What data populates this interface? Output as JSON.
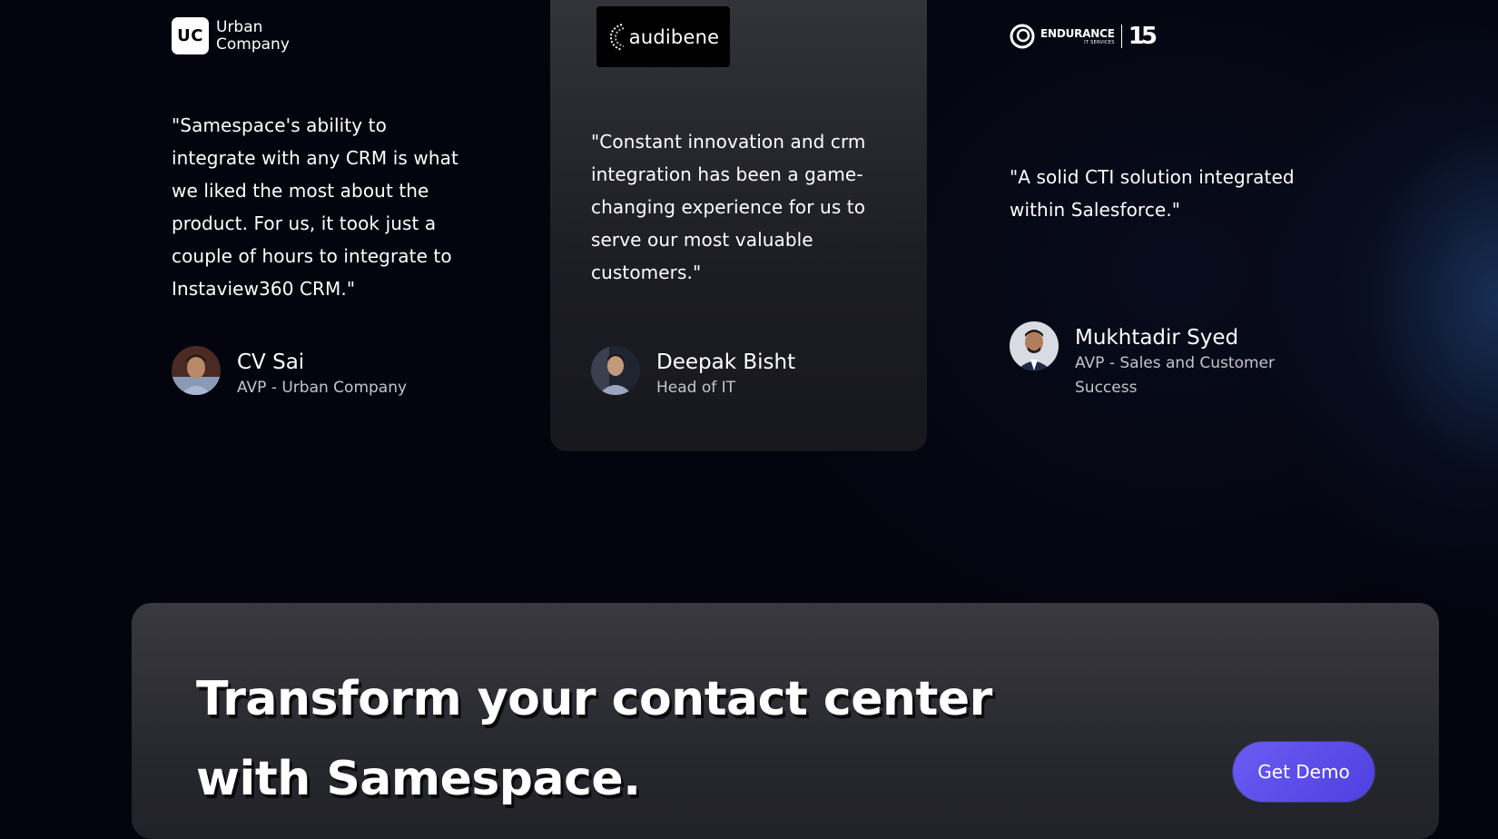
{
  "testimonials": [
    {
      "logo_words": [
        "Urban",
        "Company"
      ],
      "logo_mark": "UC",
      "quote": "\"Samespace's ability to integrate with any CRM is what we liked the most about the product. For us, it took just a couple of hours to integrate to Instaview360 CRM.\"",
      "name": "CV Sai",
      "role": "AVP - Urban Company"
    },
    {
      "logo_text": "audibene",
      "quote": "\"Constant innovation and crm integration has been a game-changing experience for us to serve our most valuable customers.\"",
      "name": "Deepak Bisht",
      "role": "Head of IT"
    },
    {
      "logo_main": "ENDURANCE",
      "logo_sub": "IT SERVICES",
      "logo_number": "15",
      "quote": "\"A solid CTI solution integrated within Salesforce.\"",
      "name": "Mukhtadir Syed",
      "role": "AVP - Sales and Customer Success"
    }
  ],
  "cta": {
    "title": "Transform your contact center with Samespace.",
    "button_label": "Get Demo"
  },
  "colors": {
    "background": "#03040e",
    "card": "#2a2a31",
    "accent": "#5b4be8",
    "muted_text": "#c4c4cc"
  },
  "icons": [
    "uc-logo-icon",
    "audibene-logo-icon",
    "endurance-logo-icon",
    "avatar-photo"
  ]
}
